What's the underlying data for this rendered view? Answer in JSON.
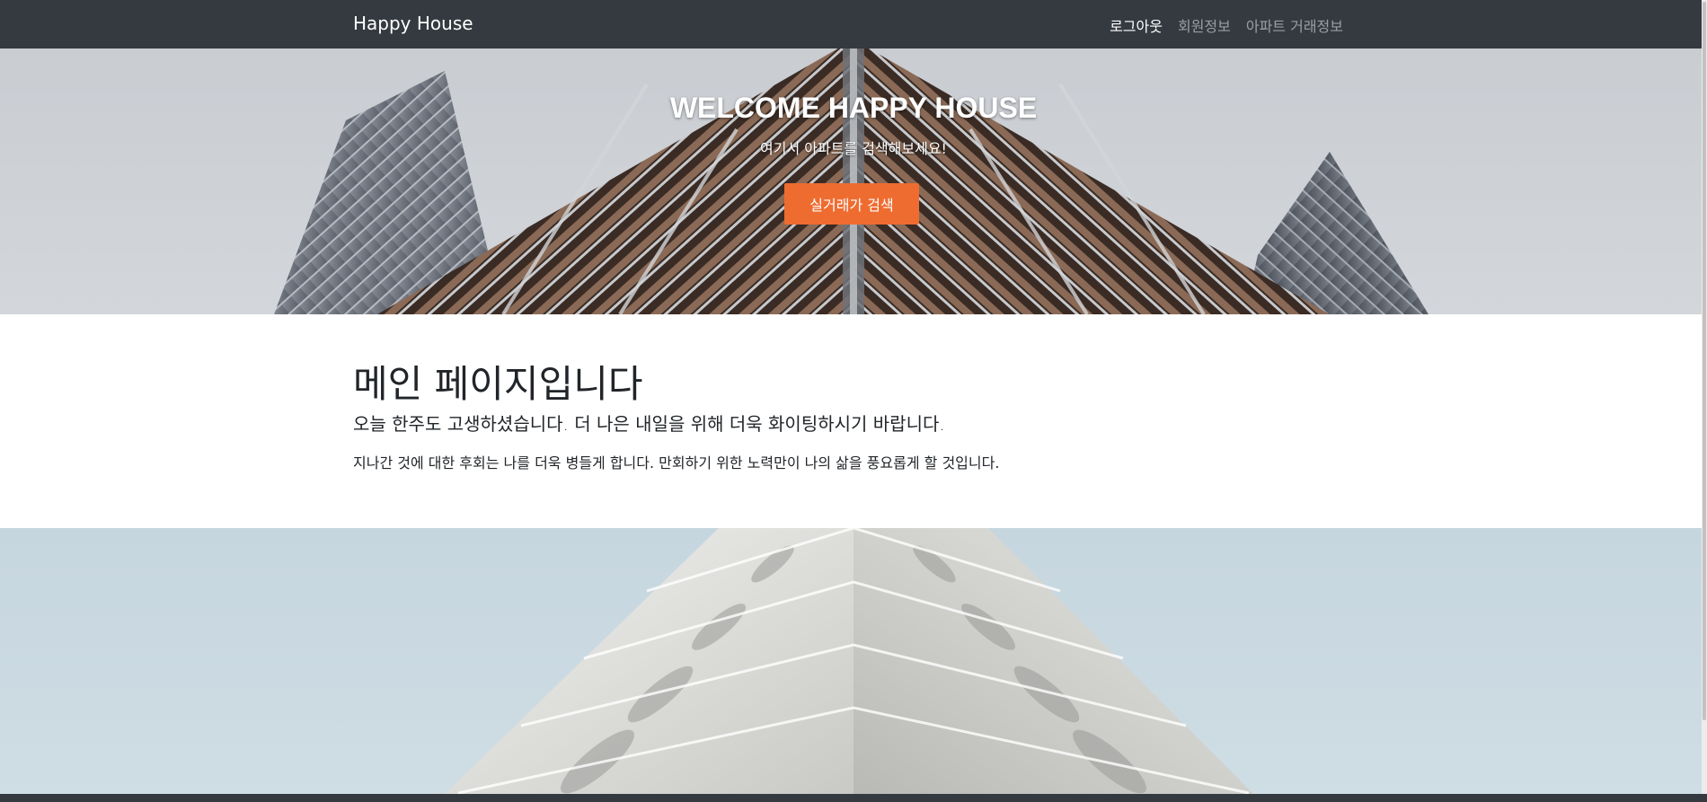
{
  "navbar": {
    "brand": "Happy House",
    "links": [
      {
        "label": "로그아웃",
        "active": true
      },
      {
        "label": "회원정보",
        "active": false
      },
      {
        "label": "아파트 거래정보",
        "active": false
      }
    ]
  },
  "hero": {
    "title": "WELCOME HAPPY HOUSE",
    "subtitle": "여기서 아파트를 검색해보세요!",
    "button_label": "실거래가 검색"
  },
  "content": {
    "title": "메인 페이지입니다",
    "lead": "오늘 한주도 고생하셨습니다. 더 나은 내일을 위해 더욱 화이팅하시기 바랍니다.",
    "text": "지나간 것에 대한 후회는 나를 더욱 병들게 합니다. 만회하기 위한 노력만이 나의 삶을 풍요롭게 할 것입니다."
  },
  "colors": {
    "navbar_bg": "#343a40",
    "accent": "#ef6c31",
    "text": "#212529"
  },
  "icons": {
    "hero_image": "building-photo",
    "bottom_image": "white-building-photo"
  }
}
